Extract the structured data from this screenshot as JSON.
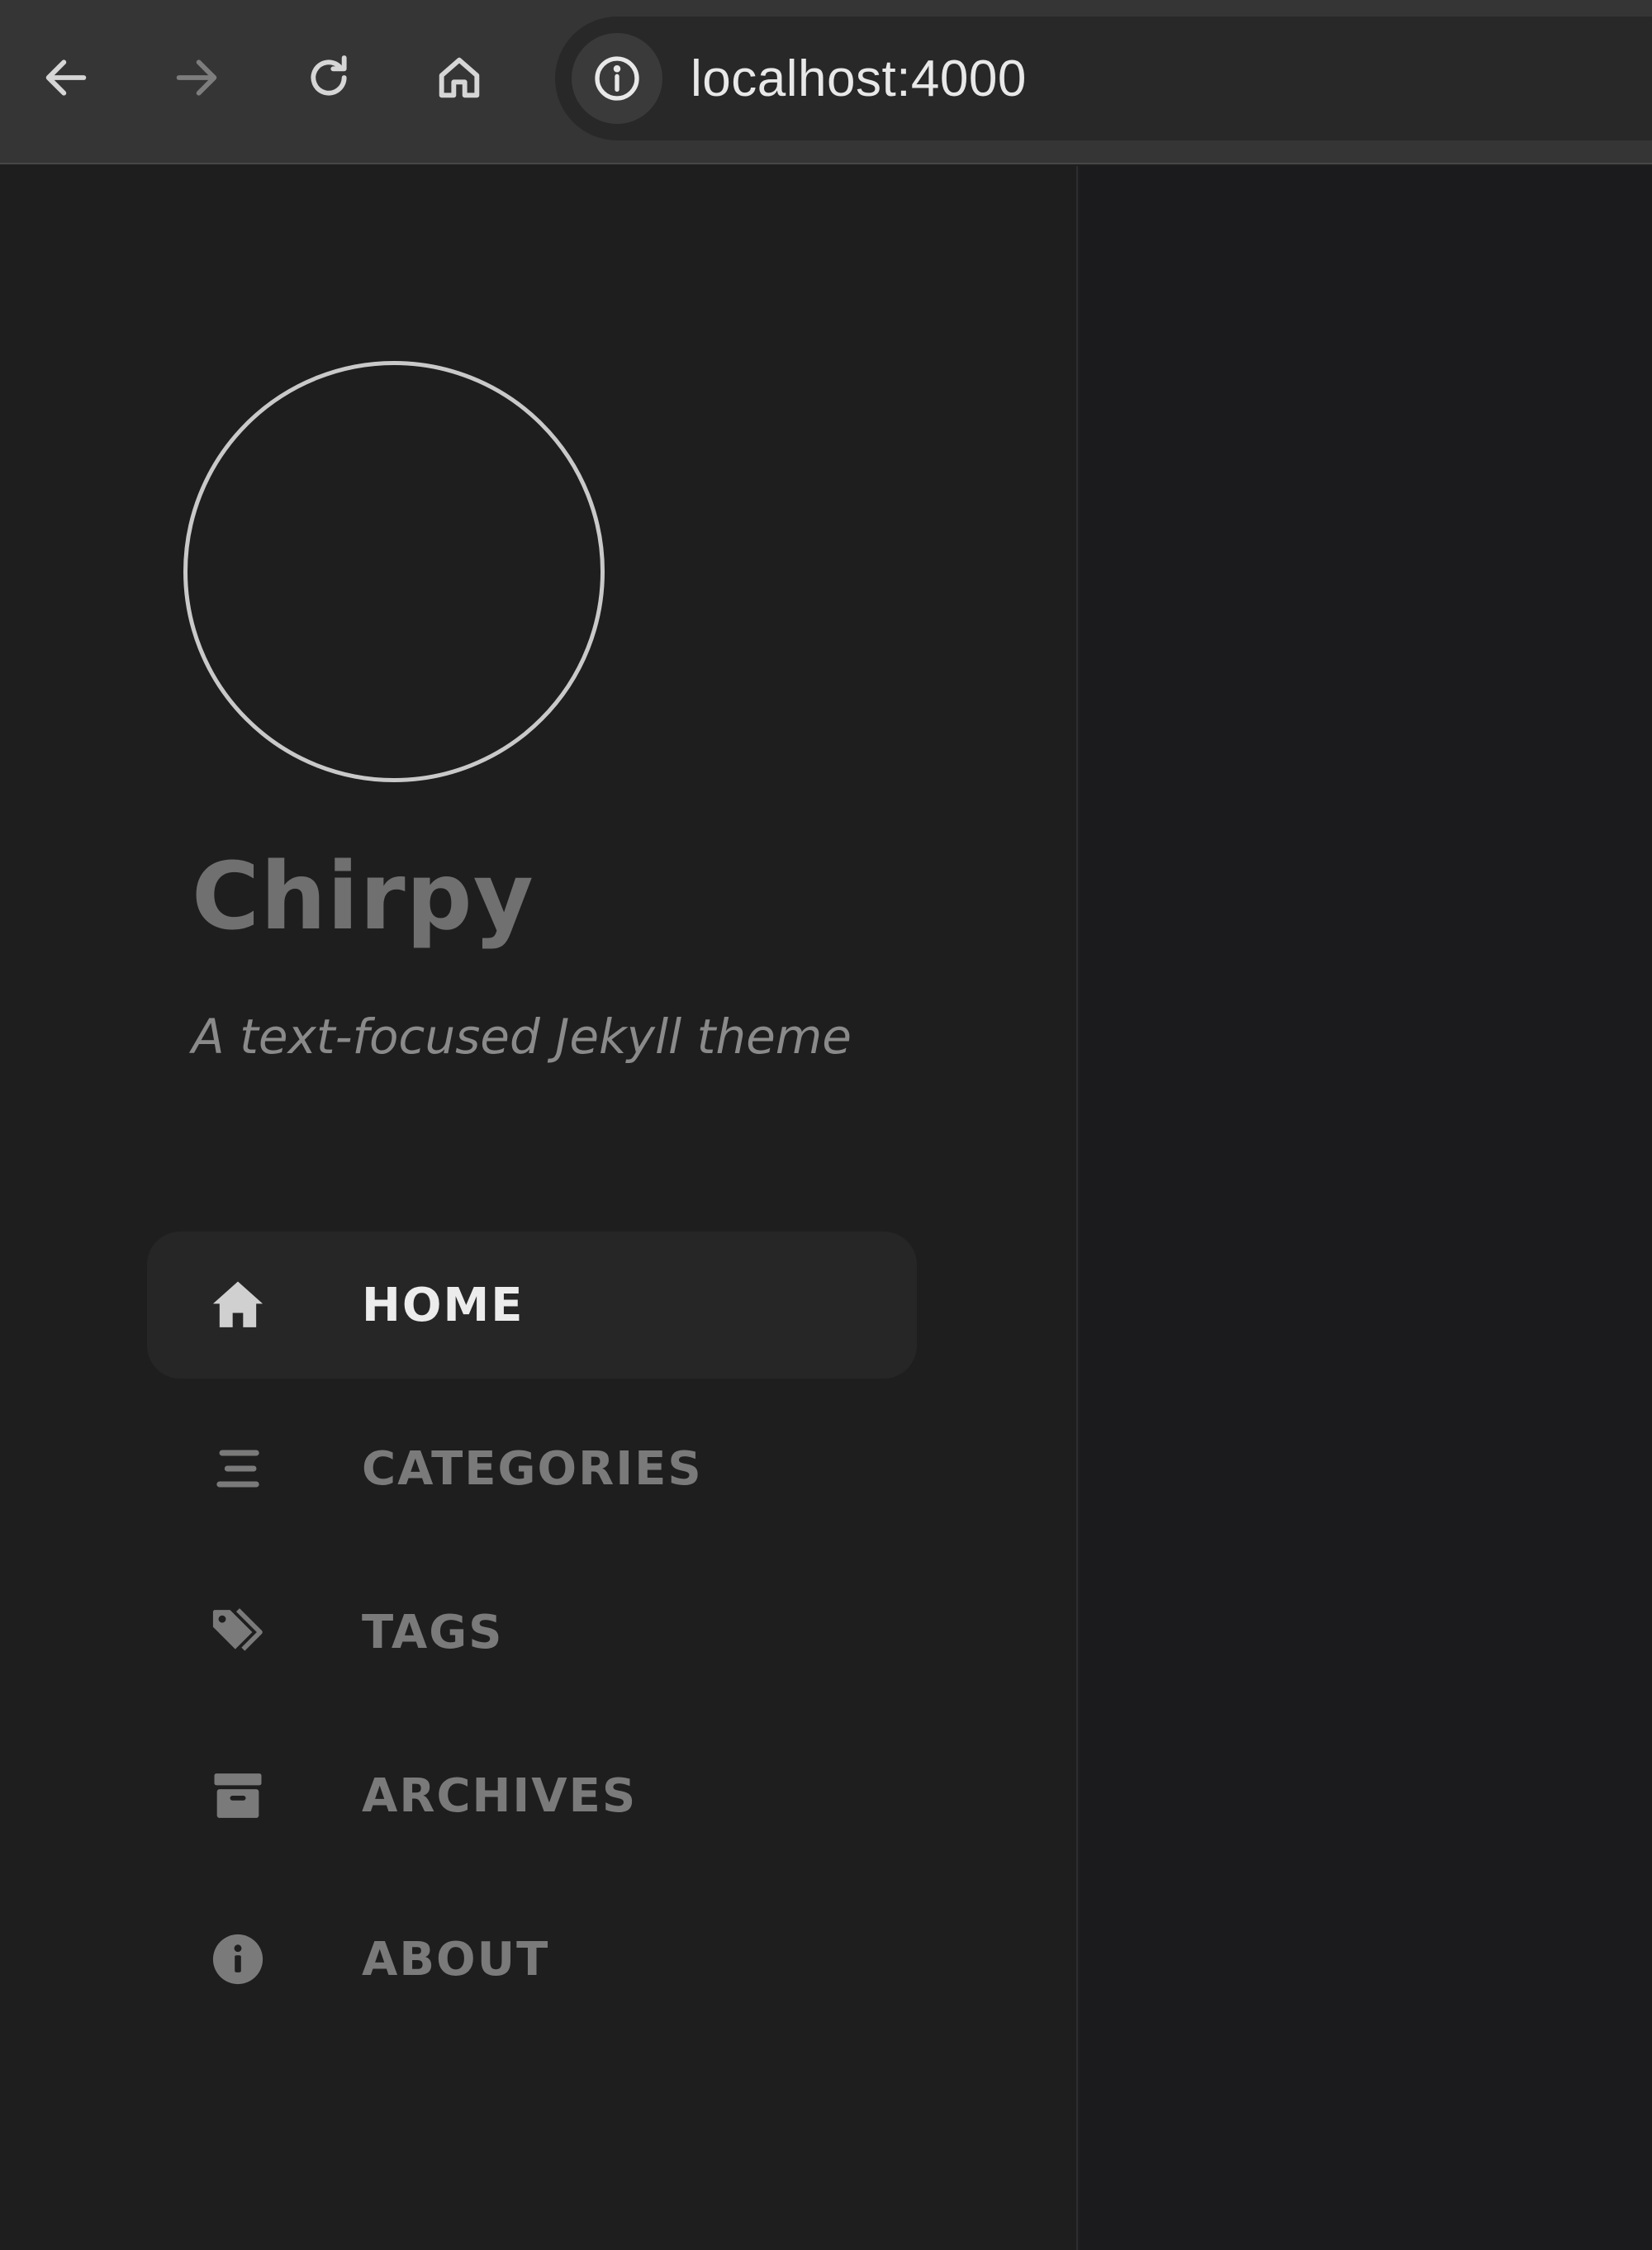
{
  "browser": {
    "url": "localhost:4000",
    "icons": {
      "back": "arrow-left-icon",
      "forward": "arrow-right-icon",
      "reload": "reload-icon",
      "home": "home-icon",
      "site_info": "info-circle-icon"
    }
  },
  "sidebar": {
    "site_title": "Chirpy",
    "site_subtitle": "A text-focused Jekyll theme",
    "items": [
      {
        "label": "HOME",
        "icon": "home-icon",
        "active": true
      },
      {
        "label": "CATEGORIES",
        "icon": "stream-icon",
        "active": false
      },
      {
        "label": "TAGS",
        "icon": "tags-icon",
        "active": false
      },
      {
        "label": "ARCHIVES",
        "icon": "archive-icon",
        "active": false
      },
      {
        "label": "ABOUT",
        "icon": "info-circle-icon",
        "active": false
      }
    ]
  },
  "colors": {
    "page_background": "#1e1e1f",
    "toolbar_background": "#353535",
    "active_nav_text": "#ececec",
    "inactive_nav_text": "#7a7a7a"
  }
}
